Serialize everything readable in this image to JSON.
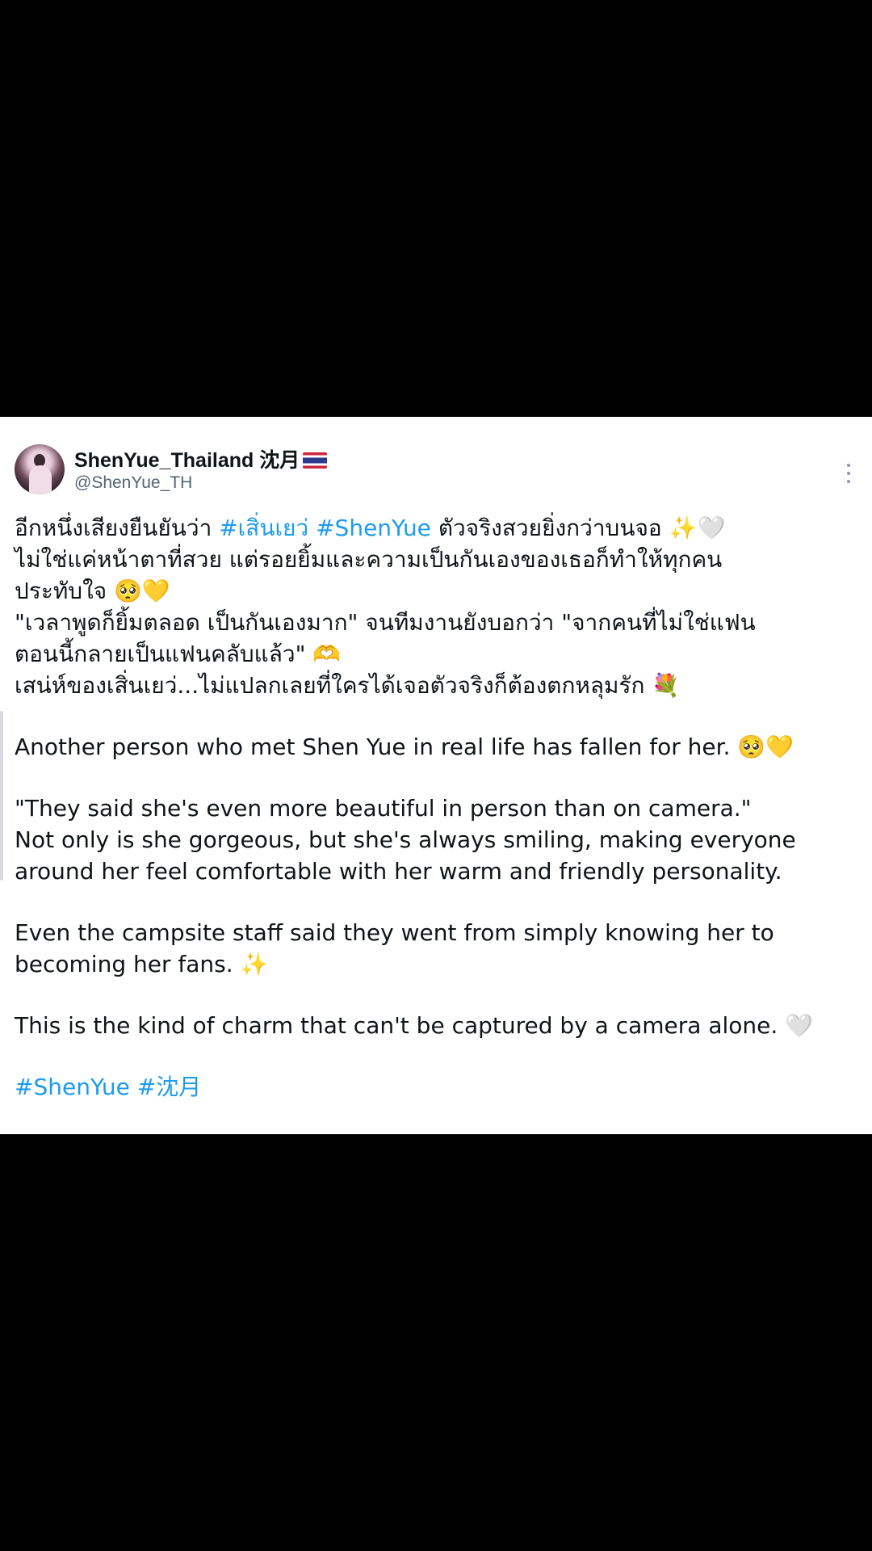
{
  "author": {
    "display_name": "ShenYue_Thailand 沈月",
    "handle": "@ShenYue_TH"
  },
  "tweet": {
    "thai_line_1_a": "อีกหนึ่งเสียงยืนยันว่า ",
    "thai_hashtag_1": "#เสิ่นเยว่",
    "thai_hashtag_2": "#ShenYue",
    "thai_line_1_b": " ตัวจริงสวยยิ่งกว่าบนจอ ✨🤍",
    "thai_line_2": "ไม่ใช่แค่หน้าตาที่สวย แต่รอยยิ้มและความเป็นกันเองของเธอก็ทำให้ทุกคน",
    "thai_line_3": "ประทับใจ 🥺💛",
    "thai_line_4": "\"เวลาพูดก็ยิ้มตลอด เป็นกันเองมาก\" จนทีมงานยังบอกว่า \"จากคนที่ไม่ใช่แฟน",
    "thai_line_5": "ตอนนี้กลายเป็นแฟนคลับแล้ว\" 🫶",
    "thai_line_6": "เสน่ห์ของเสิ่นเยว่...ไม่แปลกเลยที่ใครได้เจอตัวจริงก็ต้องตกหลุมรัก 💐",
    "en_line_1": "Another person who met Shen Yue in real life has fallen for her. 🥺💛",
    "en_line_2": "\"They said she's even more beautiful in person than on camera.\"",
    "en_line_3": "Not only is she gorgeous, but she's always smiling, making everyone",
    "en_line_4": "around her feel comfortable with her warm and friendly personality.",
    "en_line_5": "Even the campsite staff said they went from simply knowing her to",
    "en_line_6": "becoming her fans. ✨",
    "en_line_7": "This is the kind of charm that can't be captured by a camera alone. 🤍",
    "hashtag_footer_1": "#ShenYue",
    "hashtag_footer_2": "#沈月"
  },
  "colors": {
    "hashtag": "#1d9bf0",
    "text": "#0f1419",
    "handle": "#536471",
    "background": "#ffffff",
    "letterbox": "#000000"
  },
  "icons": {
    "more": "more-vertical-icon",
    "flag": "thailand-flag-icon"
  }
}
